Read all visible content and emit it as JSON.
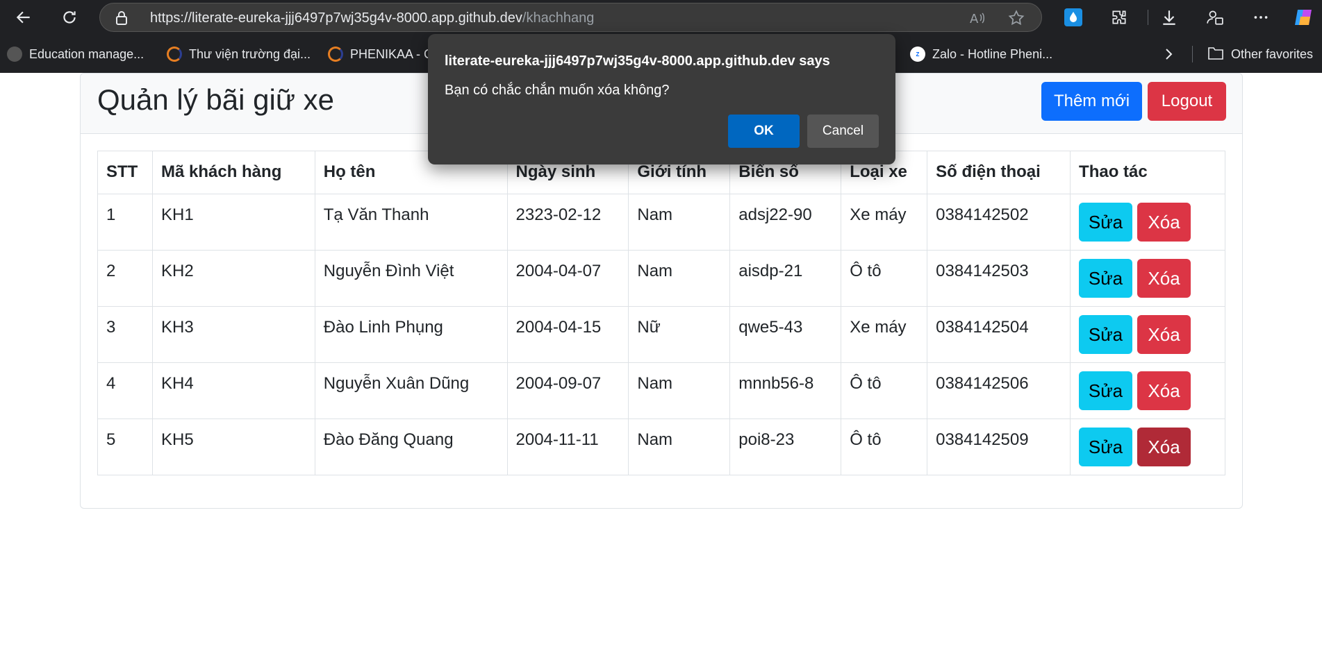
{
  "browser": {
    "url_host": "https://literate-eureka-jjj6497p7wj35g4v-8000.app.github.dev",
    "url_path": "/khachhang",
    "bookmarks": [
      {
        "label": "Education manage...",
        "color": "#c0392b"
      },
      {
        "label": "Thư viện trường đại...",
        "color": "#e67e22"
      },
      {
        "label": "PHENIKAA - C",
        "color": "#e67e22"
      },
      {
        "label": "Zalo - Hotline Pheni...",
        "color": "#0068ff"
      }
    ],
    "other_favorites": "Other favorites"
  },
  "page": {
    "title": "Quản lý bãi giữ xe",
    "add_button": "Thêm mới",
    "logout_button": "Logout"
  },
  "table": {
    "headers": [
      "STT",
      "Mã khách hàng",
      "Họ tên",
      "Ngày sinh",
      "Giới tính",
      "Biển số",
      "Loại xe",
      "Số điện thoại",
      "Thao tác"
    ],
    "rows": [
      [
        "1",
        "KH1",
        "Tạ Văn Thanh",
        "2323-02-12",
        "Nam",
        "adsj22-90",
        "Xe máy",
        "0384142502"
      ],
      [
        "2",
        "KH2",
        "Nguyễn Đình Việt",
        "2004-04-07",
        "Nam",
        "aisdp-21",
        "Ô tô",
        "0384142503"
      ],
      [
        "3",
        "KH3",
        "Đào Linh Phụng",
        "2004-04-15",
        "Nữ",
        "qwe5-43",
        "Xe máy",
        "0384142504"
      ],
      [
        "4",
        "KH4",
        "Nguyễn Xuân Dũng",
        "2004-09-07",
        "Nam",
        "mnnb56-8",
        "Ô tô",
        "0384142506"
      ],
      [
        "5",
        "KH5",
        "Đào Đăng Quang",
        "2004-11-11",
        "Nam",
        "poi8-23",
        "Ô tô",
        "0384142509"
      ]
    ],
    "edit_label": "Sửa",
    "delete_label": "Xóa"
  },
  "dialog": {
    "title": "literate-eureka-jjj6497p7wj35g4v-8000.app.github.dev says",
    "message": "Bạn có chắc chắn muốn xóa không?",
    "ok": "OK",
    "cancel": "Cancel"
  }
}
